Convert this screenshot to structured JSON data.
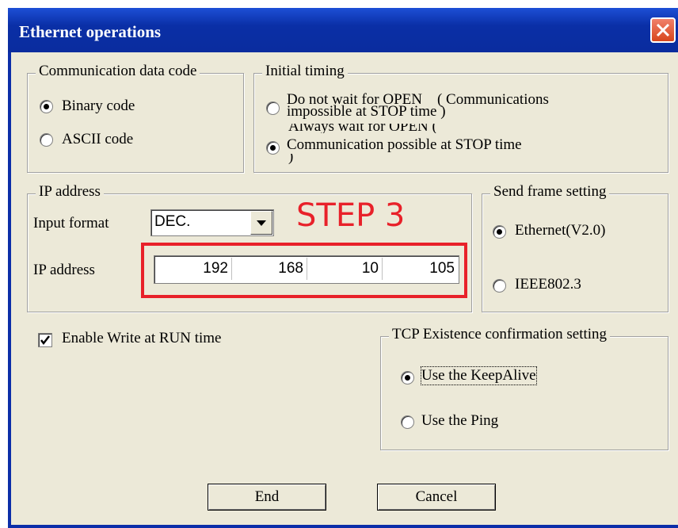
{
  "window": {
    "title": "Ethernet operations",
    "close_icon": "close-icon",
    "accent": "#0b2ea8",
    "close_color": "#d8461c"
  },
  "comm_code": {
    "legend": "Communication data code",
    "options": [
      {
        "label": "Binary code",
        "selected": true
      },
      {
        "label": "ASCII code",
        "selected": false
      }
    ]
  },
  "initial_timing": {
    "legend": "Initial timing",
    "opt1_line1": "Do not wait for OPEN　( Communications",
    "opt1_line2": "impossible at STOP time )",
    "opt2_line0": "Always wait for OPEN (",
    "opt2_line1": "Communication possible at STOP time",
    "opt2_line2": ")"
  },
  "ip_group": {
    "legend": "IP address",
    "input_format_label": "Input format",
    "input_format_value": "DEC.",
    "ip_label": "IP address",
    "octets": [
      "192",
      "168",
      "10",
      "105"
    ]
  },
  "annotation": {
    "step": "STEP 3",
    "color": "#e8212a"
  },
  "send_frame": {
    "legend": "Send frame setting",
    "options": [
      {
        "label": "Ethernet(V2.0)",
        "selected": true
      },
      {
        "label": "IEEE802.3",
        "selected": false
      }
    ]
  },
  "enable_write": {
    "label": "Enable Write at RUN time",
    "checked": true
  },
  "tcp": {
    "legend": "TCP Existence confirmation setting",
    "options": [
      {
        "label": "Use the KeepAlive",
        "selected": true
      },
      {
        "label": "Use the Ping",
        "selected": false
      }
    ]
  },
  "buttons": {
    "end": "End",
    "cancel": "Cancel"
  }
}
